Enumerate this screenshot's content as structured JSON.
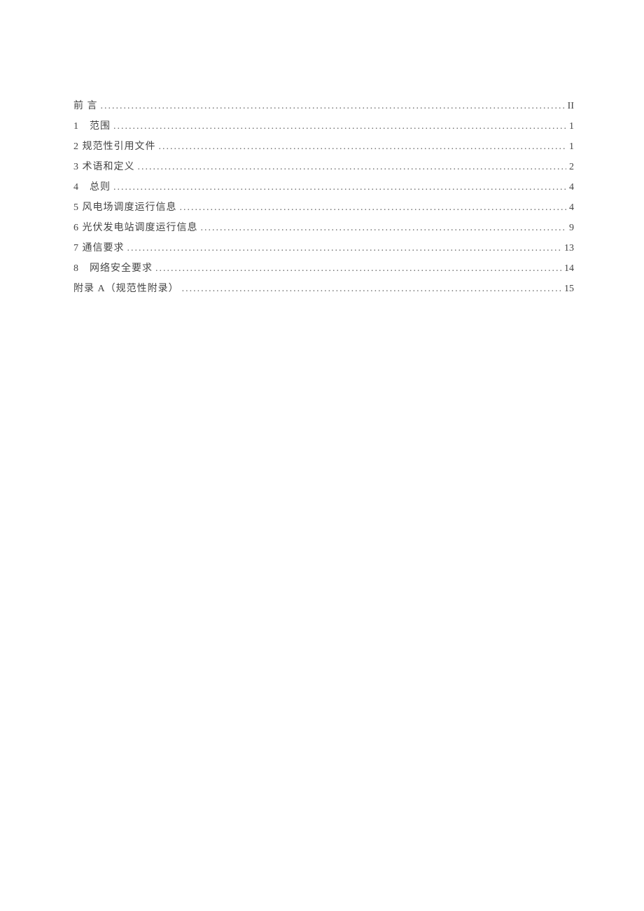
{
  "toc": {
    "entries": [
      {
        "title": "前 言",
        "page": "II"
      },
      {
        "title": "1　范围",
        "page": "1"
      },
      {
        "title": "2 规范性引用文件",
        "page": "1"
      },
      {
        "title": "3 术语和定义",
        "page": "2"
      },
      {
        "title": "4　总则",
        "page": "4"
      },
      {
        "title": "5 风电场调度运行信息",
        "page": "4"
      },
      {
        "title": "6 光伏发电站调度运行信息",
        "page": "9"
      },
      {
        "title": "7 通信要求",
        "page": "13"
      },
      {
        "title": "8　网络安全要求",
        "page": "14"
      },
      {
        "title": "附录 A（规范性附录）",
        "page": "15"
      }
    ]
  }
}
